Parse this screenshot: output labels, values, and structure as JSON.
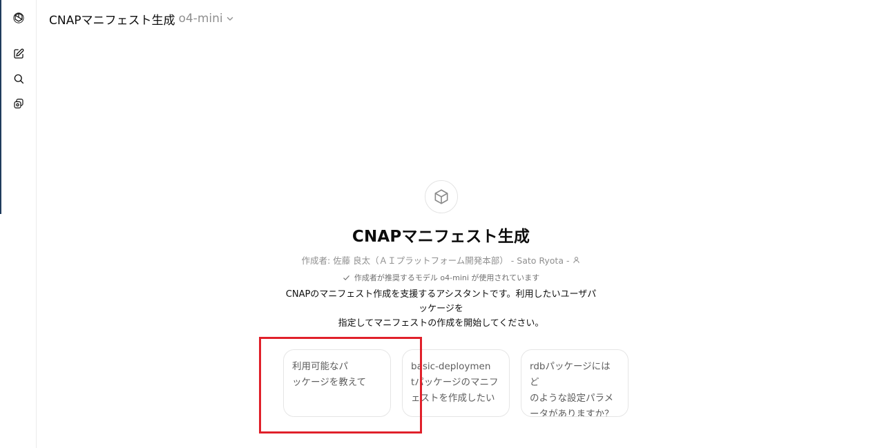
{
  "sidebar": {
    "items": [
      {
        "icon": "openai-logo-icon"
      },
      {
        "icon": "new-chat-icon"
      },
      {
        "icon": "search-icon"
      },
      {
        "icon": "library-icon"
      }
    ]
  },
  "header": {
    "gpt_name": "CNAPマニフェスト生成",
    "model": "o4-mini"
  },
  "gpt": {
    "icon": "cube-icon",
    "title": "CNAPマニフェスト生成",
    "author": "作成者: 佐藤 良太（ＡＩプラットフォーム開発本部） - Sato Ryota -",
    "recommended": "作成者が推奨するモデル o4-mini が使用されています",
    "description_line1": "CNAPのマニフェスト作成を支援するアシスタントです。利用したいユーザパッケージを",
    "description_line2": "指定してマニフェストの作成を開始してください。"
  },
  "starters": [
    {
      "line1": "利用可能なパ",
      "line2": "ッケージを教えて",
      "line3": ""
    },
    {
      "line1": "basic-deploymen",
      "line2": "tパッケージのマニフ",
      "line3": "ェストを作成したい"
    },
    {
      "line1": "rdbパッケージにはど",
      "line2": "のような設定パラメ",
      "line3": "ータがありますか？"
    }
  ],
  "colors": {
    "highlight": "#e0202a",
    "muted_text": "#8f8f8f"
  }
}
